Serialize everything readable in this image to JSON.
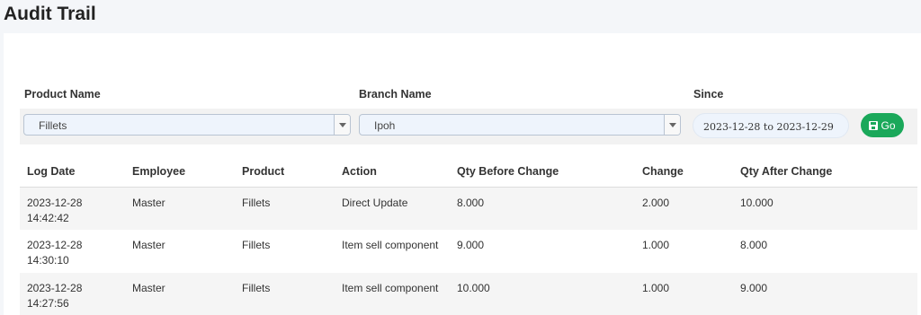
{
  "page": {
    "title": "Audit Trail"
  },
  "filters": {
    "product_label": "Product Name",
    "product_value": "Fillets",
    "branch_label": "Branch Name",
    "branch_value": "Ipoh",
    "since_label": "Since",
    "since_value": "2023-12-28 to 2023-12-29",
    "go_label": "Go",
    "go_icon": "save-icon",
    "go_color": "#1aa85a"
  },
  "table": {
    "headers": [
      "Log Date",
      "Employee",
      "Product",
      "Action",
      "Qty Before Change",
      "Change",
      "Qty After Change"
    ],
    "rows": [
      {
        "log_date": "2023-12-28",
        "log_time": "14:42:42",
        "employee": "Master",
        "product": "Fillets",
        "action": "Direct Update",
        "qty_before": "8.000",
        "change": "2.000",
        "qty_after": "10.000"
      },
      {
        "log_date": "2023-12-28",
        "log_time": "14:30:10",
        "employee": "Master",
        "product": "Fillets",
        "action": "Item sell component",
        "qty_before": "9.000",
        "change": "1.000",
        "qty_after": "8.000"
      },
      {
        "log_date": "2023-12-28",
        "log_time": "14:27:56",
        "employee": "Master",
        "product": "Fillets",
        "action": "Item sell component",
        "qty_before": "10.000",
        "change": "1.000",
        "qty_after": "9.000"
      }
    ]
  }
}
